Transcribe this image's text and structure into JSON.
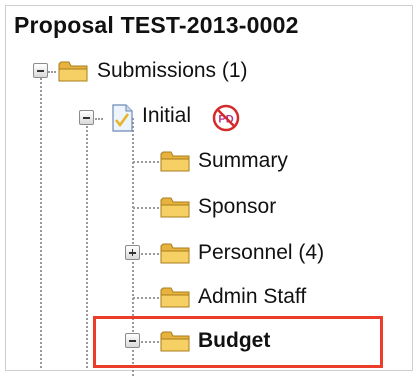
{
  "proposal": {
    "title": "Proposal TEST-2013-0002"
  },
  "tree": {
    "submissions": {
      "label": "Submissions (1)"
    },
    "initial": {
      "label": "Initial",
      "badge_text": "PD"
    },
    "summary": {
      "label": "Summary"
    },
    "sponsor": {
      "label": "Sponsor"
    },
    "personnel": {
      "label": "Personnel (4)"
    },
    "admin_staff": {
      "label": "Admin Staff"
    },
    "budget": {
      "label": "Budget"
    }
  },
  "colors": {
    "highlight": "#ea3e2a",
    "folder": "#f2c14e",
    "badge": "#d42a2a"
  },
  "icons": {
    "toggle_expanded": "minus-toggle-icon",
    "toggle_collapsed": "plus-toggle-icon",
    "folder": "folder-icon",
    "document": "document-check-icon",
    "badge": "no-pd-badge-icon"
  }
}
